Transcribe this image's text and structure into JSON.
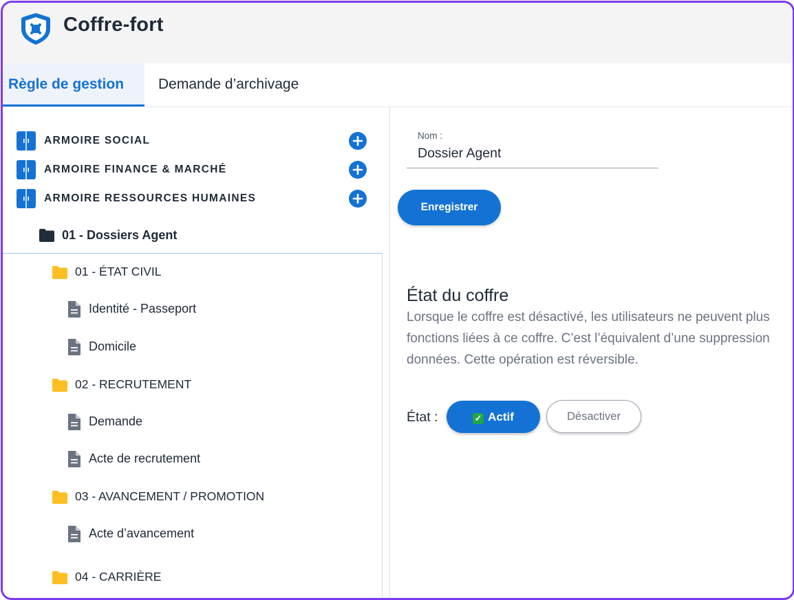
{
  "app": {
    "title": "Coffre-fort",
    "logo_icon": "shield-icon"
  },
  "tabs": [
    {
      "label": "Règle de gestion",
      "active": true
    },
    {
      "label": "Demande d’archivage",
      "active": false
    }
  ],
  "tree": {
    "armoires": [
      {
        "label": "ARMOIRE SOCIAL",
        "icon": "cabinet-icon",
        "add_icon": "plus-circle-icon"
      },
      {
        "label": "ARMOIRE FINANCE & MARCHÉ",
        "icon": "cabinet-icon",
        "add_icon": "plus-circle-icon"
      },
      {
        "label": "ARMOIRE RESSOURCES HUMAINES",
        "icon": "cabinet-icon",
        "add_icon": "plus-circle-icon"
      }
    ],
    "root_folder": {
      "label": "01 - Dossiers Agent",
      "icon": "folder-icon"
    },
    "items": [
      {
        "type": "folder",
        "label": "01 - ÉTAT CIVIL"
      },
      {
        "type": "doc",
        "label": "Identité - Passeport"
      },
      {
        "type": "doc",
        "label": "Domicile"
      },
      {
        "type": "folder",
        "label": "02 - RECRUTEMENT"
      },
      {
        "type": "doc",
        "label": "Demande"
      },
      {
        "type": "doc",
        "label": "Acte de recrutement"
      },
      {
        "type": "folder",
        "label": "03 - AVANCEMENT / PROMOTION"
      },
      {
        "type": "doc",
        "label": "Acte d’avancement"
      },
      {
        "type": "folder",
        "label": "04 - CARRIÈRE"
      }
    ]
  },
  "form": {
    "name_label": "Nom :",
    "name_value": "Dossier Agent",
    "save_label": "Enregistrer"
  },
  "status_section": {
    "title": "État du coffre",
    "description_lines": [
      "Lorsque le coffre est désactivé, les utilisateurs ne peuvent plus",
      "fonctions liées à ce coffre. C’est l’équivalent d’une suppression",
      "données. Cette opération est réversible."
    ],
    "state_label": "État :",
    "active_label": "Actif",
    "active_emoji": "✅",
    "deactivate_label": "Désactiver"
  },
  "colors": {
    "accent": "#1472d4",
    "frame": "#7c3aed",
    "folder": "#fbbf24",
    "root_folder": "#1f2d3d",
    "doc_icon": "#6b7280"
  }
}
